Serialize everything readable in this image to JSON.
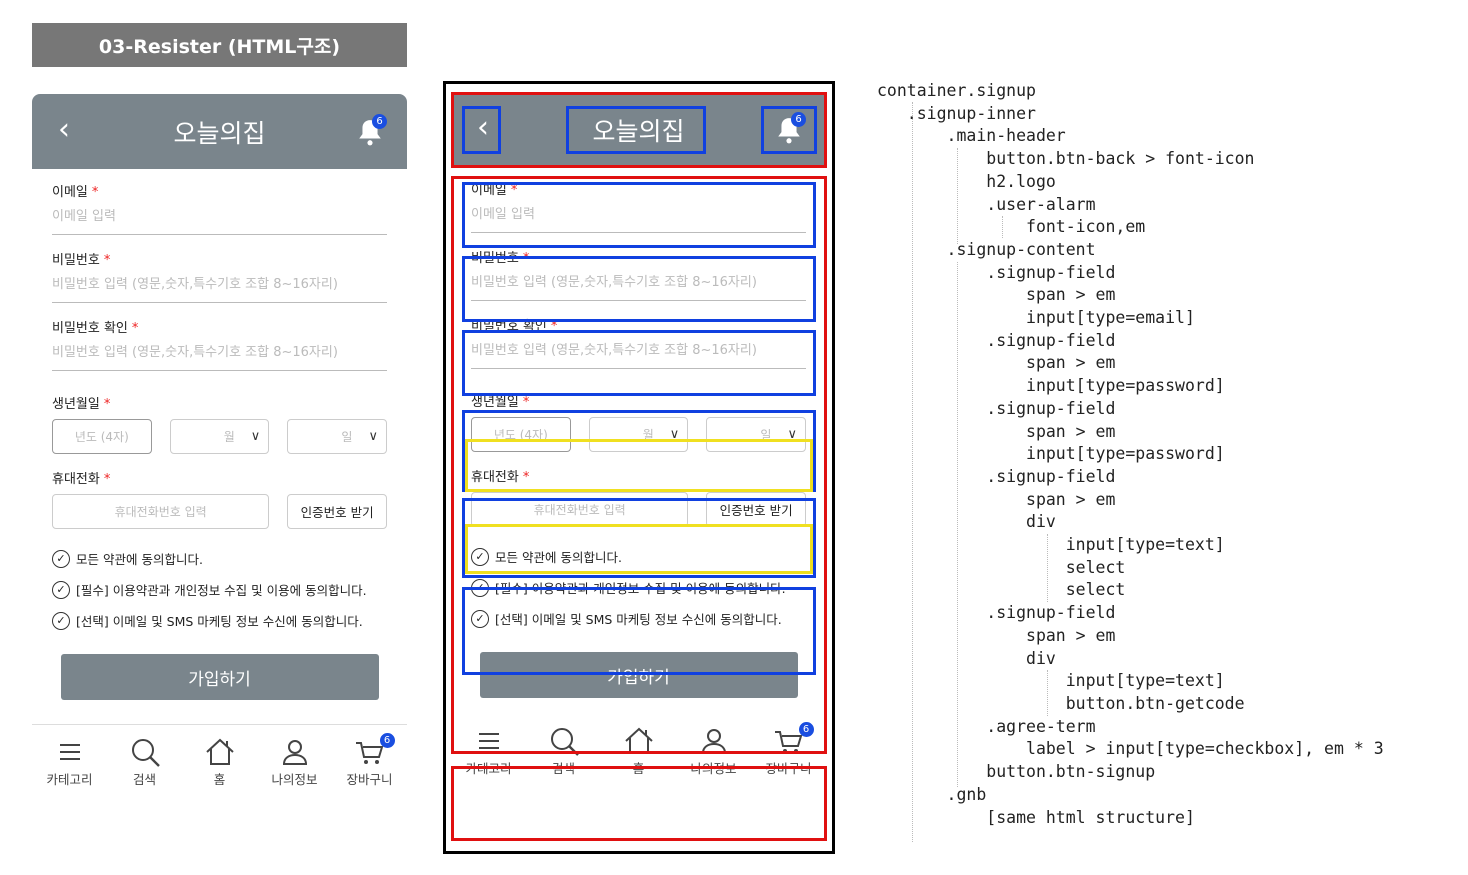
{
  "slide_title": "03-Resister (HTML구조)",
  "app": {
    "logo": "오늘의집",
    "alarm_count": "6",
    "fields": {
      "email": {
        "label": "이메일",
        "required": "*",
        "placeholder": "이메일 입력"
      },
      "password": {
        "label": "비밀번호",
        "required": "*",
        "placeholder": "비밀번호 입력 (영문,숫자,특수기호 조합 8~16자리)"
      },
      "password_confirm": {
        "label": "비밀번호 확인",
        "required": "*",
        "placeholder": "비밀번호 입력 (영문,숫자,특수기호 조합 8~16자리)"
      },
      "birth": {
        "label": "생년월일",
        "required": "*",
        "year_placeholder": "년도 (4자)",
        "month_value": "월",
        "day_value": "일"
      },
      "phone": {
        "label": "휴대전화",
        "required": "*",
        "placeholder": "휴대전화번호 입력",
        "getcode_label": "인증번호 받기"
      }
    },
    "agree": [
      "모든 약관에 동의합니다.",
      "[필수] 이용약관과 개인정보 수집 및 이용에 동의합니다.",
      "[선택] 이메일 및 SMS 마케팅 정보 수신에 동의합니다."
    ],
    "signup_label": "가입하기",
    "gnb": [
      "카테고리",
      "검색",
      "홈",
      "나의정보",
      "장바구니"
    ],
    "cart_count": "6"
  },
  "code_lines": [
    "container.signup",
    "   .signup-inner",
    "       .main-header",
    "           button.btn-back > font-icon",
    "           h2.logo",
    "           .user-alarm",
    "               font-icon,em",
    "       .signup-content",
    "           .signup-field",
    "               span > em",
    "               input[type=email]",
    "           .signup-field",
    "               span > em",
    "               input[type=password]",
    "           .signup-field",
    "               span > em",
    "               input[type=password]",
    "           .signup-field",
    "               span > em",
    "               div",
    "                   input[type=text]",
    "                   select",
    "                   select",
    "           .signup-field",
    "               span > em",
    "               div",
    "                   input[type=text]",
    "                   button.btn-getcode",
    "           .agree-term",
    "               label > input[type=checkbox], em * 3",
    "           button.btn-signup",
    "       .gnb",
    "           [same html structure]"
  ]
}
